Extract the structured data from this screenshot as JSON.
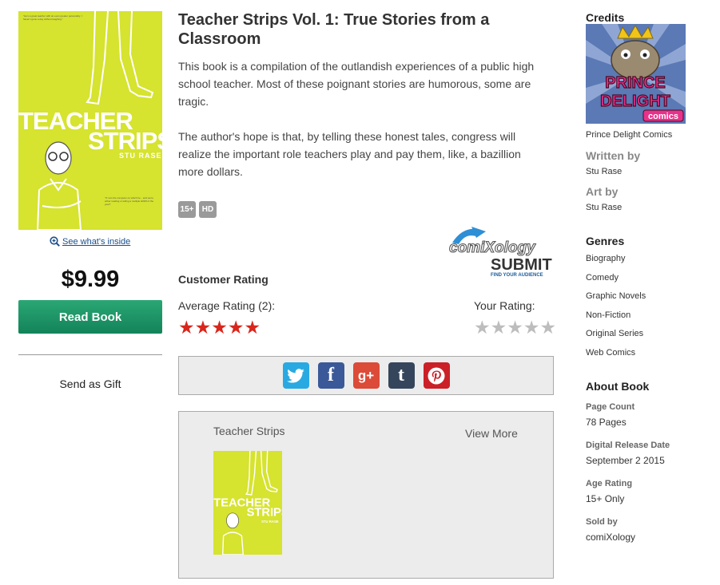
{
  "cover": {
    "title_line1": "TEACHER",
    "title_line2": "STRIPS",
    "author": "STU RASE",
    "quote_top": "\"He's a great teacher with an even greater personality. I haven't gone a day without laughing.\"",
    "quote_bottom": "\"If I am the computer on which he... and we're either reading or telling a multiple HDMI of the year!\""
  },
  "see_inside": "See what's inside",
  "price": "$9.99",
  "read_button": "Read Book",
  "send_gift": "Send as Gift",
  "book": {
    "title": "Teacher Strips Vol. 1: True Stories from a Classroom",
    "description": [
      "This book is a compilation of the outlandish experiences of a public high school teacher. Most of these poignant stories are humorous, some are tragic.",
      "The author's hope is that, by telling these honest tales, congress will realize the important role teachers play and pay them, like, a bazillion more dollars."
    ],
    "badges": [
      "15+",
      "HD"
    ]
  },
  "submit_logo": {
    "brand": "comiXology",
    "word": "SUBMIT",
    "tagline": "FIND YOUR AUDIENCE"
  },
  "rating": {
    "heading": "Customer Rating",
    "average_label": "Average Rating (2):",
    "average_stars": 5,
    "your_label": "Your Rating:",
    "your_stars": 0,
    "max_stars": 5
  },
  "share": [
    "twitter-icon",
    "facebook-icon",
    "google-plus-icon",
    "tumblr-icon",
    "pinterest-icon"
  ],
  "share_glyphs": {
    "fb": "f",
    "gp": "g+",
    "tb": "t"
  },
  "series": {
    "name": "Teacher Strips",
    "view_more": "View More"
  },
  "credits": {
    "heading": "Credits",
    "logo_line1": "PRINCE",
    "logo_line2": "DELIGHT",
    "logo_line3": "comics",
    "publisher": "Prince Delight Comics",
    "written_by_label": "Written by",
    "writer": "Stu Rase",
    "art_by_label": "Art by",
    "artist": "Stu Rase"
  },
  "genres": {
    "heading": "Genres",
    "items": [
      "Biography",
      "Comedy",
      "Graphic Novels",
      "Non-Fiction",
      "Original Series",
      "Web Comics"
    ]
  },
  "about": {
    "heading": "About Book",
    "page_count_label": "Page Count",
    "page_count": "78 Pages",
    "release_label": "Digital Release Date",
    "release": "September 2 2015",
    "age_label": "Age Rating",
    "age": "15+ Only",
    "sold_label": "Sold by",
    "sold": "comiXology"
  },
  "colors": {
    "cover_bg": "#d6e32f",
    "button_green": "#13835a",
    "star_red": "#d9261c",
    "star_grey": "#bdbdbd"
  }
}
